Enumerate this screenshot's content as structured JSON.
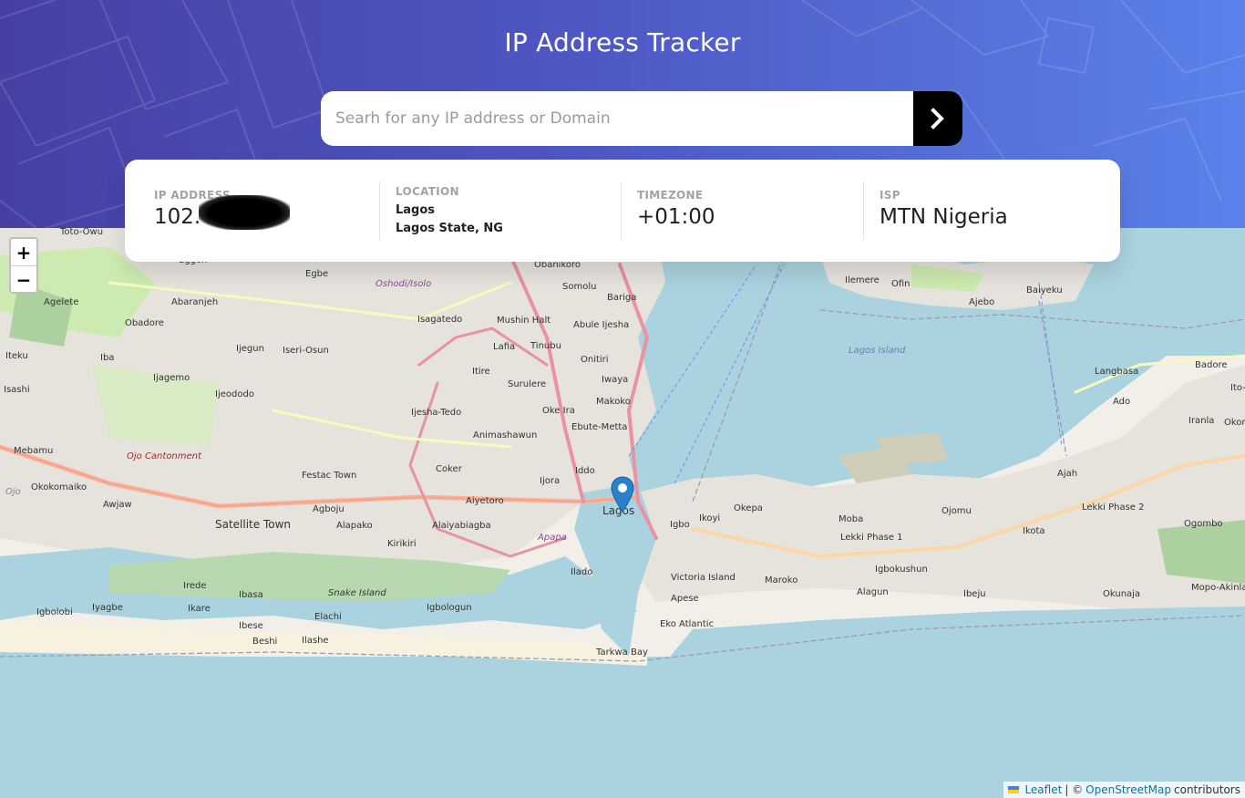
{
  "header": {
    "title": "IP Address Tracker",
    "search_placeholder": "Searh for any IP address or Domain",
    "search_value": "",
    "submit_icon": "chevron-right-icon"
  },
  "info": {
    "ip": {
      "label": "IP Address",
      "value": "102."
    },
    "location": {
      "label": "Location",
      "city": "Lagos",
      "region": "Lagos State, NG"
    },
    "timezone": {
      "label": "Timezone",
      "value": "+01:00"
    },
    "isp": {
      "label": "ISP",
      "value": "MTN Nigeria"
    }
  },
  "map": {
    "zoom_in": "+",
    "zoom_out": "−",
    "marker_icon": "map-pin-icon",
    "attribution": {
      "leaflet": "Leaflet",
      "separator": "| ©",
      "osm": "OpenStreetMap",
      "suffix": "contributors"
    },
    "labels": [
      "Toto-Owu",
      "Eggon",
      "Egbe",
      "Oshodi/Isolo",
      "Obanikoro",
      "Somolu",
      "Bariga",
      "Ilemere",
      "Ofin",
      "Ajebo",
      "Baiyeku",
      "Agelete",
      "Abaranjeh",
      "Obadore",
      "Isagatedo",
      "Mushin Halt",
      "Abule Ijesha",
      "Iteku",
      "Iba",
      "Ijegun",
      "Iseri-Osun",
      "Lafia",
      "Tinubu",
      "Onitiri",
      "Lagos Island",
      "Langbasa",
      "Badore",
      "Ijagemo",
      "Itire",
      "Iwaya",
      "Ito-",
      "Isashi",
      "Ijeododo",
      "Surulere",
      "Makoko",
      "Ado",
      "Ijesha-Tedo",
      "Oke Ira",
      "Ebute-Metta",
      "Iranla",
      "Okon",
      "Mebamu",
      "Animashawun",
      "Ojo Cantonment",
      "Festac Town",
      "Coker",
      "Iddo",
      "Ajah",
      "Ojo",
      "Okokomaiko",
      "Ijora",
      "Awjaw",
      "Agboju",
      "Aiyetoro",
      "Okepa",
      "Ojomu",
      "Lekki Phase 2",
      "Ogombo",
      "Satellite Town",
      "Alapako",
      "Alaiyabiagba",
      "Lagos",
      "Igbo",
      "Ikoyi",
      "Moba",
      "Lekki Phase 1",
      "Ikota",
      "Kirikiri",
      "Apapa",
      "Ilado",
      "Victoria Island",
      "Maroko",
      "Igbokushun",
      "Irede",
      "Ibasa",
      "Snake Island",
      "Alagun",
      "Ibeju",
      "Okunaja",
      "Mopo-Akinlade",
      "Igbolobi",
      "Iyagbe",
      "Ikare",
      "Igbologun",
      "Apese",
      "Elachi",
      "Ibese",
      "Eko Atlantic",
      "Beshi",
      "Ilashe",
      "Tarkwa Bay"
    ]
  }
}
